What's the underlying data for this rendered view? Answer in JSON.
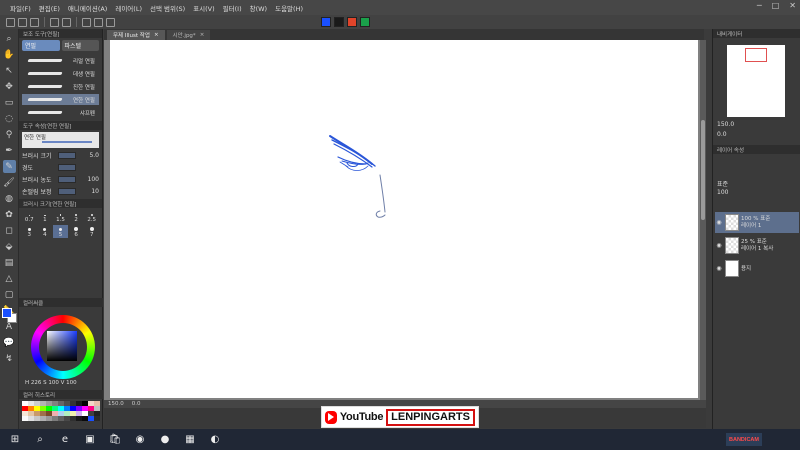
{
  "menu": [
    "파일(F)",
    "편집(E)",
    "애니메이션(A)",
    "레이어(L)",
    "선택 범위(S)",
    "표시(V)",
    "필터(I)",
    "창(W)",
    "도움말(H)"
  ],
  "window_controls": [
    "─",
    "□",
    "✕"
  ],
  "command_bar": {
    "icons": [
      "new-file-icon",
      "open-file-icon",
      "save-icon",
      "undo-icon",
      "redo-icon",
      "transform-icon",
      "snap-icon",
      "ruler-icon"
    ],
    "colors": [
      "#1a50ff",
      "#1a1a1a",
      "#e0442a",
      "#1aa04a"
    ]
  },
  "tools": [
    "zoom-icon",
    "hand-icon",
    "operation-icon",
    "move-icon",
    "selection-icon",
    "auto-select-icon",
    "eyedropper-icon",
    "pen-icon",
    "pencil-icon",
    "brush-icon",
    "airbrush-icon",
    "decoration-icon",
    "eraser-icon",
    "fill-icon",
    "gradient-icon",
    "figure-icon",
    "frame-icon",
    "ruler-tool-icon",
    "text-icon",
    "balloon-icon",
    "correct-line-icon"
  ],
  "subtool_panel": {
    "header": "보조 도구[연필]",
    "tabs": [
      "연필",
      "파스텔"
    ],
    "brushes": [
      "리얼 연필",
      "데생 연필",
      "진한 연필",
      "연한 연필",
      "샤프펜"
    ],
    "selected_brush_index": 3
  },
  "tool_property": {
    "header": "도구 속성[연한 연필]",
    "preview_label": "연한 연필",
    "rows": [
      {
        "label": "브러시 크기",
        "value": "5.0"
      },
      {
        "label": "경도",
        "value": ""
      },
      {
        "label": "브러시 농도",
        "value": "100"
      },
      {
        "label": "손떨림 보정",
        "value": "10"
      }
    ]
  },
  "brush_size": {
    "header": "브러시 크기[연한 연필]",
    "sizes": [
      "0.7",
      "1",
      "1.5",
      "2",
      "2.5",
      "3",
      "4",
      "5",
      "6",
      "7"
    ],
    "selected_index": 7
  },
  "color_wheel": {
    "header": "컬러써클",
    "readout": "H 226 S 100 V 100",
    "main_color": "#1a50ff"
  },
  "palette": {
    "header": "컬러 히스토리",
    "colors": [
      "#ffffff",
      "#e6e6e6",
      "#cccccc",
      "#b3b3b3",
      "#999999",
      "#808080",
      "#666666",
      "#4d4d4d",
      "#333333",
      "#1a1a1a",
      "#000000",
      "#f2d8c9",
      "#e8bfa8",
      "#ff0000",
      "#ff8000",
      "#ffff00",
      "#80ff00",
      "#00ff00",
      "#00ff80",
      "#00ffff",
      "#0080ff",
      "#0000ff",
      "#8000ff",
      "#ff00ff",
      "#ff0080",
      "#c0c0c0",
      "#f5e6d6",
      "#e3c6a6",
      "#c99a6a",
      "#a0704a",
      "#7a4a2a",
      "#f0b0b0",
      "#b0d0f0",
      "#b0f0c0",
      "#f0f0b0",
      "#d0b0f0",
      "#ffffff",
      "#404040",
      "#202020",
      "#fafafa",
      "#e0e0e0",
      "#c8c8c8",
      "#b0b0b0",
      "#989898",
      "#7c7c7c",
      "#606060",
      "#484848",
      "#303030",
      "#181818",
      "#0a0a0a",
      "#1a50ff",
      "#2a2a2a"
    ]
  },
  "doc_tabs": [
    {
      "label": "무제 Illust 작업",
      "active": true
    },
    {
      "label": "시안.jpg*",
      "active": false
    }
  ],
  "status": {
    "zoom": "150.0",
    "angle": "0.0"
  },
  "navigator": {
    "header": "내비게이터",
    "zoom": "150.0",
    "angle": "0.0"
  },
  "layer_panel": {
    "header": "레이어 속성",
    "blend": "표준",
    "opacity": "100",
    "layers": [
      {
        "line1": "100 % 표준",
        "line2": "레이어 1",
        "selected": true,
        "checker": true
      },
      {
        "line1": "25 % 표준",
        "line2": "레이어 1 복사",
        "selected": false,
        "checker": true
      },
      {
        "line1": "",
        "line2": "용지",
        "selected": false,
        "checker": false
      }
    ]
  },
  "watermark": {
    "platform": "YouTube",
    "channel": "LENPINGARTS"
  },
  "taskbar": {
    "icons": [
      "start-icon",
      "search-icon",
      "edge-icon",
      "explorer-icon",
      "store-icon",
      "chrome-icon",
      "record-icon",
      "app-icon",
      "clip-studio-icon"
    ],
    "bandicam_a": "BANDI",
    "bandicam_b": "CAM"
  }
}
